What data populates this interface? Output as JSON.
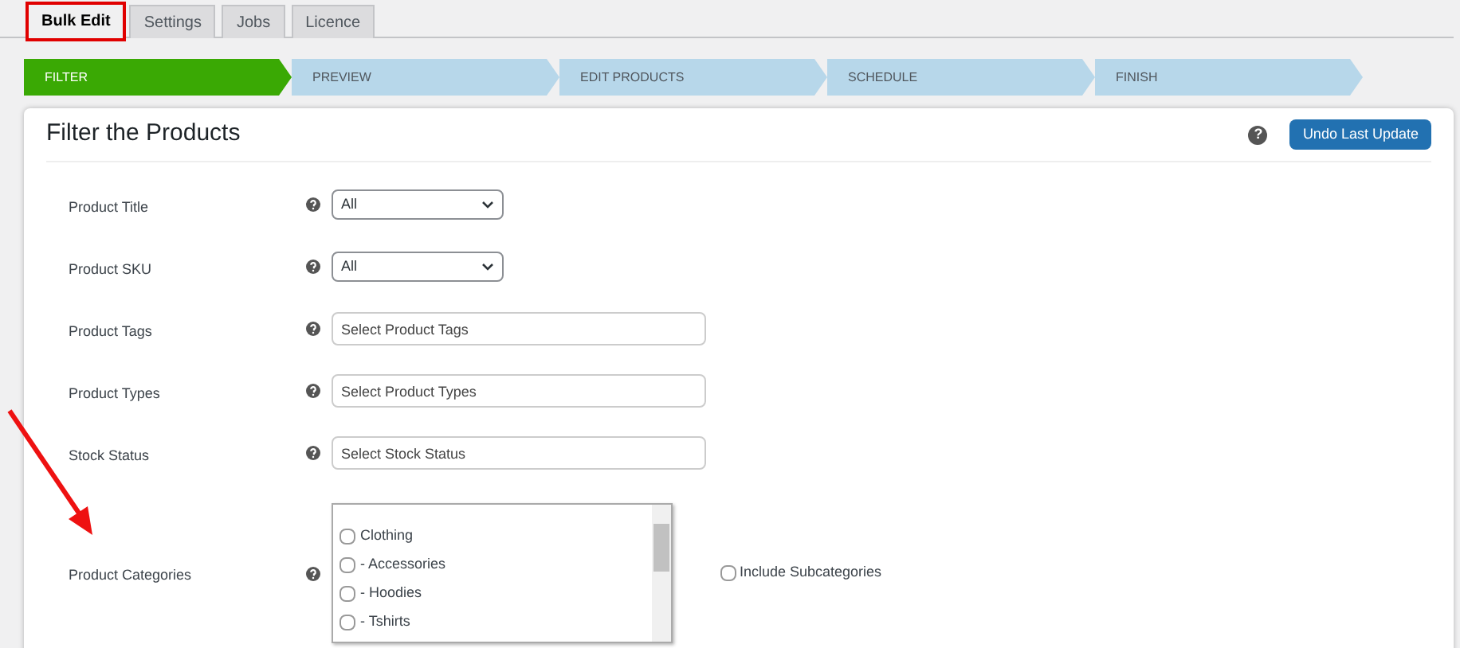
{
  "tabs": [
    {
      "label": "Bulk Edit",
      "selected": true,
      "outlined": true
    },
    {
      "label": "Settings",
      "selected": false,
      "outlined": false
    },
    {
      "label": "Jobs",
      "selected": false,
      "outlined": false
    },
    {
      "label": "Licence",
      "selected": false,
      "outlined": false
    }
  ],
  "steps": [
    {
      "label": "FILTER",
      "selected": true
    },
    {
      "label": "PREVIEW",
      "selected": false
    },
    {
      "label": "EDIT PRODUCTS",
      "selected": false
    },
    {
      "label": "SCHEDULE",
      "selected": false
    },
    {
      "label": "FINISH",
      "selected": false
    }
  ],
  "card": {
    "title": "Filter the Products",
    "help": "?",
    "button": "Undo Last Update",
    "rows": [
      {
        "label": "Product Title",
        "kind": "select",
        "value": "All"
      },
      {
        "label": "Product SKU",
        "kind": "select",
        "value": "All"
      },
      {
        "label": "Product Tags",
        "kind": "text",
        "placeholder": "Select Product Tags"
      },
      {
        "label": "Product Types",
        "kind": "text",
        "placeholder": "Select Product Types"
      },
      {
        "label": "Stock Status",
        "kind": "text",
        "placeholder": "Select Stock Status"
      },
      {
        "label": "Product Categories",
        "kind": "listbox",
        "options": [
          {
            "label": "Clothing",
            "checked": false
          },
          {
            "label": "- Accessories",
            "checked": false
          },
          {
            "label": "- Hoodies",
            "checked": false
          },
          {
            "label": "- Tshirts",
            "checked": false
          }
        ],
        "extra": {
          "label": "Include Subcategories",
          "checked": false
        }
      }
    ]
  },
  "annotations": [
    {
      "kind": "arrow"
    }
  ]
}
